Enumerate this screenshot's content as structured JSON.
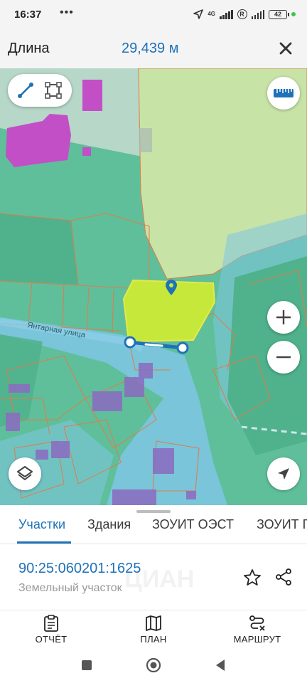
{
  "status_bar": {
    "time": "16:37",
    "more_dots": "•••",
    "network_type": "4G",
    "battery_level": "42",
    "r_badge": "R"
  },
  "measure": {
    "label": "Длина",
    "value": "29,439 м"
  },
  "map": {
    "street_label": "Янтарная улица",
    "colors": {
      "base": "#5fbf9a",
      "water": "#7fc6e4",
      "highlight": "#c6e83a",
      "light_parcel": "#c8e3a6",
      "building": "#8a6fc0",
      "magenta_building": "#c24fc6",
      "parcel_border": "#e07b4a",
      "measure_line": "#1f72b8"
    },
    "controls": {
      "line_mode_icon": "line-measure-icon",
      "area_mode_icon": "area-measure-icon",
      "ruler_icon": "ruler-icon",
      "zoom_in_icon": "plus-icon",
      "zoom_out_icon": "minus-icon",
      "layers_icon": "layers-icon",
      "location_icon": "navigation-arrow-icon"
    }
  },
  "tabs": [
    {
      "label": "Участки",
      "active": true
    },
    {
      "label": "Здания",
      "active": false
    },
    {
      "label": "ЗОУИТ ОЭСТ",
      "active": false
    },
    {
      "label": "ЗОУИТ Г",
      "active": false
    }
  ],
  "parcel": {
    "cadastral_number": "90:25:060201:1625",
    "type": "Земельный участок",
    "watermark": "ЦИАН",
    "star_icon": "star-icon",
    "share_icon": "share-icon"
  },
  "actions": [
    {
      "label": "ОТЧЁТ",
      "icon": "clipboard-icon"
    },
    {
      "label": "ПЛАН",
      "icon": "map-icon"
    },
    {
      "label": "МАРШРУТ",
      "icon": "route-icon"
    }
  ],
  "navigation": {
    "recent_icon": "square-icon",
    "home_icon": "circle-icon",
    "back_icon": "back-triangle-icon"
  }
}
